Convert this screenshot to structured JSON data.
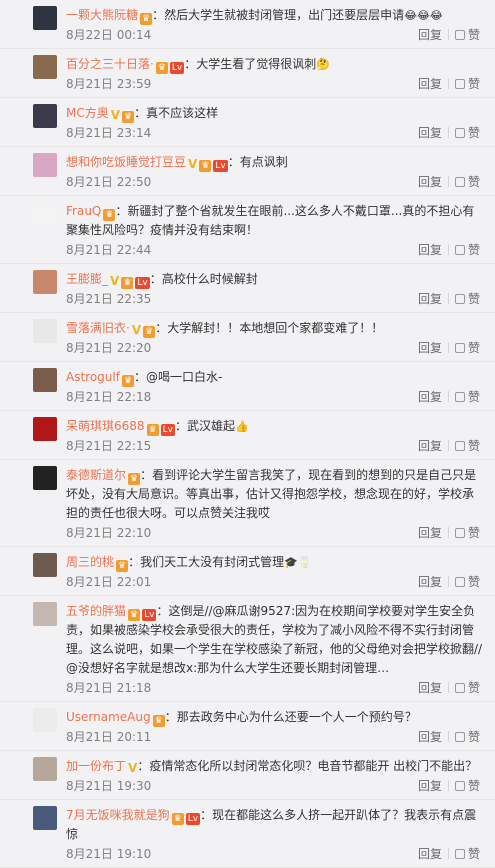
{
  "labels": {
    "reply": "回复",
    "like": "赞"
  },
  "comments": [
    {
      "user": "一颗大熊阮糖",
      "badges": [
        "vip"
      ],
      "text": "：然后大学生就被封闭管理，出门还要层层申请",
      "emoji": "😂😂😂",
      "time": "8月22日 00:14",
      "avatar_color": "#2e3440"
    },
    {
      "user": "百分之三十日落·",
      "badges": [
        "vip",
        "red"
      ],
      "text": "：大学生看了觉得很讽刺",
      "emoji": "🤔",
      "time": "8月21日 23:59",
      "avatar_color": "#8a6a4f"
    },
    {
      "user": "MC方奥",
      "badges": [
        "v",
        "vip"
      ],
      "text": "：真不应该这样",
      "emoji": "",
      "time": "8月21日 23:14",
      "avatar_color": "#3a3a4a"
    },
    {
      "user": "想和你吃饭睡觉打豆豆",
      "badges": [
        "v",
        "vip",
        "red"
      ],
      "text": "：有点讽刺",
      "emoji": "",
      "time": "8月21日 22:50",
      "avatar_color": "#d9a6c4"
    },
    {
      "user": "FrauQ",
      "badges": [
        "vip"
      ],
      "text": "：新疆封了整个省就发生在眼前...这么多人不戴口罩...真的不担心有聚集性风险吗？疫情并没有结束啊！",
      "emoji": "",
      "time": "8月21日 22:44",
      "avatar_color": "#f3f3f3"
    },
    {
      "user": "王膨膨_",
      "badges": [
        "v",
        "vip",
        "red"
      ],
      "text": "：高校什么时候解封",
      "emoji": "",
      "time": "8月21日 22:35",
      "avatar_color": "#c9876b"
    },
    {
      "user": "雪落满旧衣·",
      "badges": [
        "v",
        "vip"
      ],
      "text": "：大学解封！！本地想回个家都变难了！！",
      "emoji": "",
      "time": "8月21日 22:20",
      "avatar_color": "#e8e8e8"
    },
    {
      "user": "Astrogulf",
      "badges": [
        "vip"
      ],
      "text": "：@喝一口白水-",
      "emoji": "",
      "time": "8月21日 22:18",
      "avatar_color": "#7a5c4a"
    },
    {
      "user": "呆萌琪琪6688",
      "badges": [
        "vip",
        "red"
      ],
      "text": "：武汉雄起",
      "emoji": "👍",
      "time": "8月21日 22:15",
      "avatar_color": "#b01818"
    },
    {
      "user": "泰德斯道尔",
      "badges": [
        "vip"
      ],
      "text": "：看到评论大学生留言我笑了，现在看到的想到的只是自己只是坏处，没有大局意识。等真出事，估计又得抱怨学校，想念现在的好，学校承担的责任也很大呀。可以点赞关注我哎",
      "emoji": "",
      "time": "8月21日 22:10",
      "avatar_color": "#222222"
    },
    {
      "user": "周三的桃",
      "badges": [
        "vip"
      ],
      "text": "：我们天工大没有封闭式管理",
      "emoji": "🎓🥛",
      "time": "8月21日 22:01",
      "avatar_color": "#6e5a4e"
    },
    {
      "user": "五爷的胖猫",
      "badges": [
        "vip",
        "red"
      ],
      "text": "：这倒是//@麻瓜谢9527:因为在校期间学校要对学生安全负责，如果被感染学校会承受很大的责任，学校为了减小风险不得不实行封闭管理。这么说吧，如果一个学生在学校感染了新冠，他的父母绝对会把学校掀翻//@没想好名字就是想改x:那为什么大学生还要长期封闭管理…",
      "emoji": "",
      "time": "8月21日 21:18",
      "avatar_color": "#c4b8b0"
    },
    {
      "user": "UsernameAug",
      "badges": [
        "vip"
      ],
      "text": "：那去政务中心为什么还要一个人一个预约号？",
      "emoji": "",
      "time": "8月21日 20:11",
      "avatar_color": "#ececec"
    },
    {
      "user": "加一份布丁",
      "badges": [
        "v"
      ],
      "text": "：疫情常态化所以封闭常态化呗？电音节都能开 出校门不能出？",
      "emoji": "",
      "time": "8月21日 19:30",
      "avatar_color": "#b5a89a"
    },
    {
      "user": "7月无饭咪我就是狗",
      "badges": [
        "vip",
        "red"
      ],
      "text": "：现在都能这么多人挤一起开趴体了？我表示有点震惊",
      "emoji": "",
      "time": "8月21日 19:10",
      "avatar_color": "#4a5a7a"
    }
  ]
}
